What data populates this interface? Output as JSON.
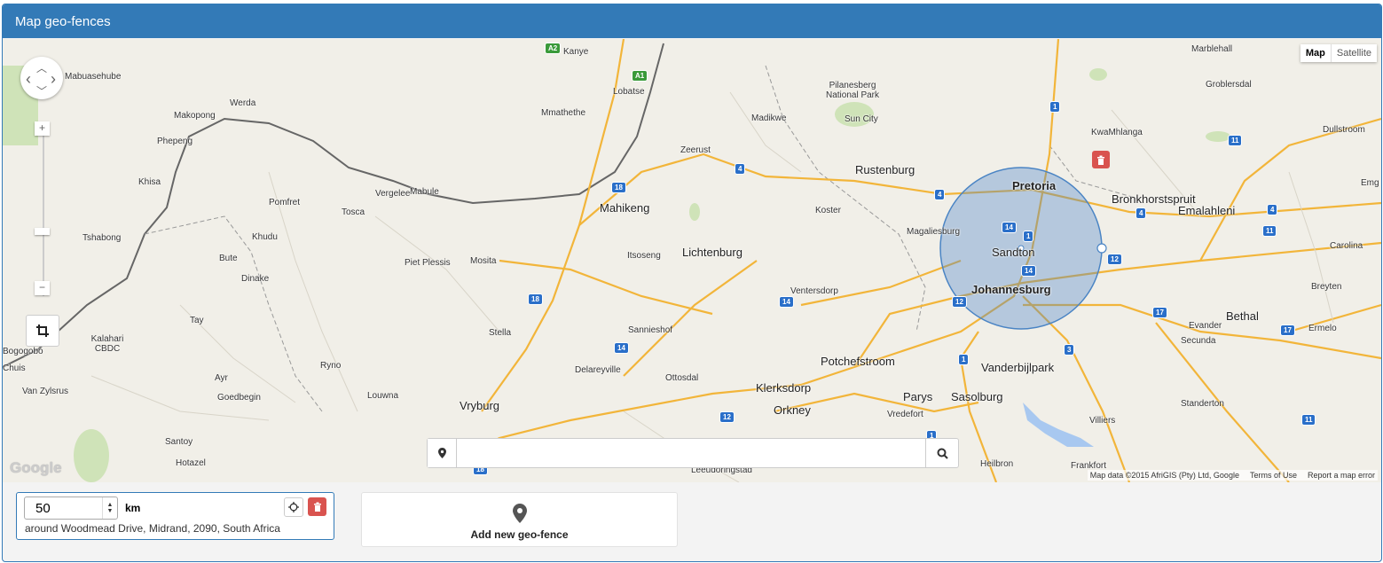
{
  "header": {
    "title": "Map geo-fences"
  },
  "map": {
    "type_controls": {
      "map": "Map",
      "satellite": "Satellite"
    },
    "pan": {
      "up": "︿",
      "left": "‹",
      "right": "›",
      "down": "﹀"
    },
    "zoom": {
      "in": "+",
      "out": "−"
    },
    "draw_icon": "crop-icon",
    "logo": "Google",
    "attribution": {
      "data": "Map data ©2015 AfriGIS (Pty) Ltd, Google",
      "terms": "Terms of Use",
      "report": "Report a map error"
    },
    "places": [
      {
        "name": "Kanye",
        "big": false
      },
      {
        "name": "Lobatse",
        "big": false
      },
      {
        "name": "Mmathethe",
        "big": false
      },
      {
        "name": "Mabuasehube",
        "big": false
      },
      {
        "name": "Werda",
        "big": false
      },
      {
        "name": "Makopong",
        "big": false
      },
      {
        "name": "Phepeng",
        "big": false
      },
      {
        "name": "Khisa",
        "big": false
      },
      {
        "name": "Tshabong",
        "big": false
      },
      {
        "name": "Vergelee",
        "big": false
      },
      {
        "name": "Mabule",
        "big": false
      },
      {
        "name": "Pomfret",
        "big": false
      },
      {
        "name": "Tosca",
        "big": false
      },
      {
        "name": "Khudu",
        "big": false
      },
      {
        "name": "Bute",
        "big": false
      },
      {
        "name": "Dinake",
        "big": false
      },
      {
        "name": "Tay",
        "big": false
      },
      {
        "name": "Kalahari CBDC",
        "big": false
      },
      {
        "name": "Bogogobo",
        "big": false
      },
      {
        "name": "Chuis",
        "big": false
      },
      {
        "name": "Van Zylsrus",
        "big": false
      },
      {
        "name": "Ayr",
        "big": false
      },
      {
        "name": "Goedbegin",
        "big": false
      },
      {
        "name": "Ryno",
        "big": false
      },
      {
        "name": "Louwna",
        "big": false
      },
      {
        "name": "Santoy",
        "big": false
      },
      {
        "name": "Hotazel",
        "big": false
      },
      {
        "name": "Piet Plessis",
        "big": false
      },
      {
        "name": "Mosita",
        "big": false
      },
      {
        "name": "Mahikeng",
        "big": true
      },
      {
        "name": "Zeerust",
        "big": false
      },
      {
        "name": "Itsoseng",
        "big": false
      },
      {
        "name": "Lichtenburg",
        "big": true
      },
      {
        "name": "Stella",
        "big": false
      },
      {
        "name": "Sannieshof",
        "big": false
      },
      {
        "name": "Delareyville",
        "big": false
      },
      {
        "name": "Ottosdal",
        "big": false
      },
      {
        "name": "Vryburg",
        "big": true
      },
      {
        "name": "Leeudoringstad",
        "big": false
      },
      {
        "name": "Madikwe",
        "big": false
      },
      {
        "name": "Pilanesberg National Park",
        "big": false
      },
      {
        "name": "Sun City",
        "big": false
      },
      {
        "name": "Rustenburg",
        "big": true
      },
      {
        "name": "Koster",
        "big": false
      },
      {
        "name": "Magaliesburg",
        "big": false
      },
      {
        "name": "Ventersdorp",
        "big": false
      },
      {
        "name": "Potchefstroom",
        "big": true
      },
      {
        "name": "Klerksdorp",
        "big": true
      },
      {
        "name": "Orkney",
        "big": true
      },
      {
        "name": "Parys",
        "big": true
      },
      {
        "name": "Vredefort",
        "big": false
      },
      {
        "name": "Sasolburg",
        "big": true
      },
      {
        "name": "Vanderbijlpark",
        "big": true
      },
      {
        "name": "Heilbron",
        "big": false
      },
      {
        "name": "Frankfort",
        "big": false
      },
      {
        "name": "Villiers",
        "big": false
      },
      {
        "name": "Pretoria",
        "big": true
      },
      {
        "name": "Sandton",
        "big": true
      },
      {
        "name": "Johannesburg",
        "big": true
      },
      {
        "name": "Bronkhorstspruit",
        "big": true
      },
      {
        "name": "Emalahleni",
        "big": true
      },
      {
        "name": "Marblehall",
        "big": false
      },
      {
        "name": "Groblersdal",
        "big": false
      },
      {
        "name": "KwaMhlanga",
        "big": false
      },
      {
        "name": "Dullstroom",
        "big": false
      },
      {
        "name": "Carolina",
        "big": false
      },
      {
        "name": "Breyten",
        "big": false
      },
      {
        "name": "Evander",
        "big": false
      },
      {
        "name": "Secunda",
        "big": false
      },
      {
        "name": "Bethal",
        "big": true
      },
      {
        "name": "Ermelo",
        "big": false
      },
      {
        "name": "Standerton",
        "big": false
      },
      {
        "name": "Emg",
        "big": false
      }
    ],
    "shields": [
      "A2",
      "A1",
      "4",
      "18",
      "18",
      "14",
      "14",
      "12",
      "14",
      "4",
      "1",
      "1",
      "14",
      "12",
      "12",
      "1",
      "3",
      "4",
      "4",
      "11",
      "11",
      "17",
      "17",
      "11",
      "1",
      "18"
    ],
    "fence_delete_icon": "trash-icon",
    "search": {
      "placeholder": "",
      "value": ""
    }
  },
  "fence": {
    "radius": "50",
    "unit": "km",
    "address": "around Woodmead Drive, Midrand, 2090, South Africa",
    "locate_icon": "crosshairs-icon",
    "delete_icon": "trash-icon"
  },
  "add_fence": {
    "label": "Add new geo-fence",
    "icon": "map-marker-icon"
  }
}
